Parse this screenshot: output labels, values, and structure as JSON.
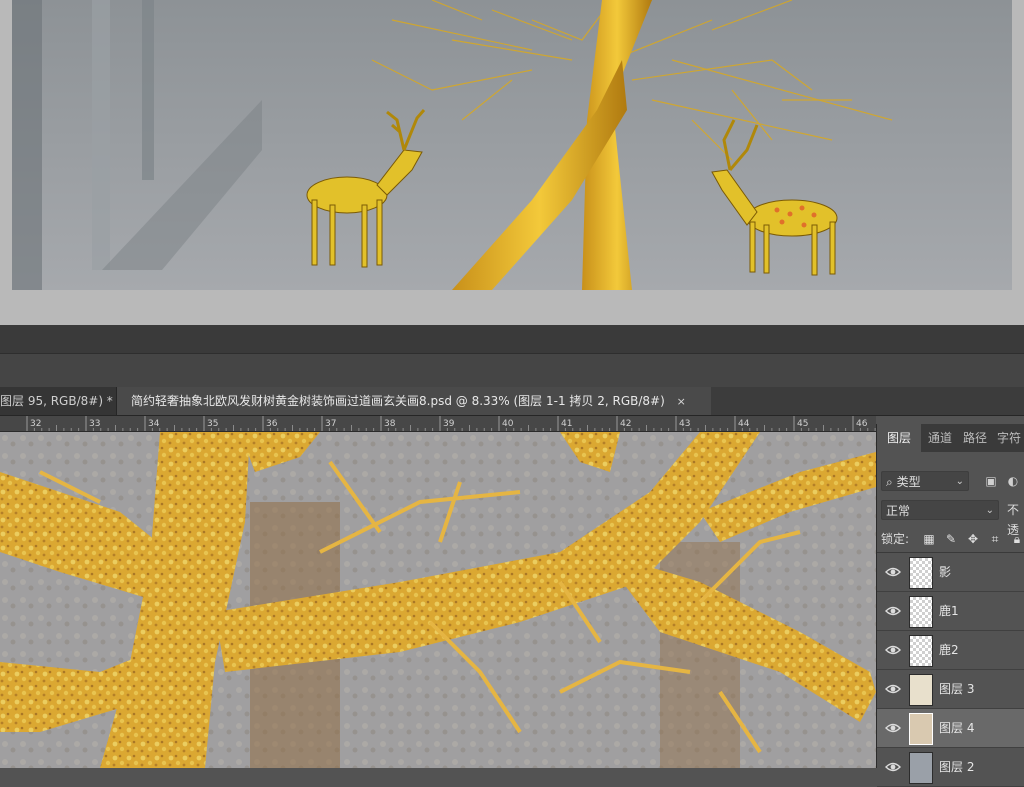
{
  "tabs": [
    {
      "label": "图层 95, RGB/8#) *",
      "close": "×"
    },
    {
      "label": "简约轻奢抽象北欧风发财树黄金树装饰画过道画玄关画8.psd @ 8.33% (图层 1-1 拷贝 2, RGB/8#)",
      "close": "×"
    }
  ],
  "ruler": {
    "ticks": [
      "32",
      "33",
      "34",
      "35",
      "36",
      "37",
      "38",
      "39",
      "40",
      "41",
      "42",
      "43",
      "44",
      "45",
      "46"
    ]
  },
  "panel": {
    "tabs": [
      "图层",
      "通道",
      "路径",
      "字符"
    ],
    "filter_label": "类型",
    "blend_mode": "正常",
    "opacity_label": "不透",
    "lock_label": "锁定:",
    "layers": [
      {
        "name": "影",
        "visible": true,
        "selected": false
      },
      {
        "name": "鹿1",
        "visible": true,
        "selected": false
      },
      {
        "name": "鹿2",
        "visible": true,
        "selected": false
      },
      {
        "name": "图层 3",
        "visible": true,
        "selected": false
      },
      {
        "name": "图层 4",
        "visible": true,
        "selected": true
      },
      {
        "name": "图层 2",
        "visible": true,
        "selected": false
      }
    ]
  },
  "colors": {
    "ui_dark": "#3c3c3c",
    "panel": "#535353",
    "gold": "#e0a816",
    "gold_light": "#f3cf3a",
    "canvas_bg": "#9a9a9e"
  }
}
